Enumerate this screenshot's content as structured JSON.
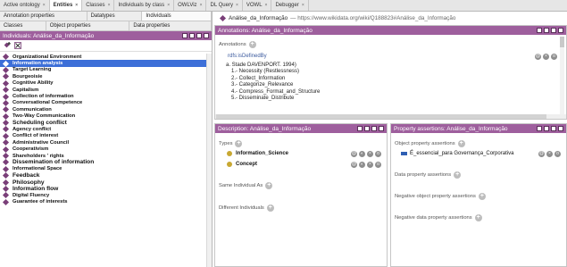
{
  "tabs": [
    {
      "label": "Active ontology",
      "active": false
    },
    {
      "label": "Entities",
      "active": true
    },
    {
      "label": "Classes",
      "active": false
    },
    {
      "label": "Individuals by class",
      "active": false
    },
    {
      "label": "OWLViz",
      "active": false
    },
    {
      "label": "DL Query",
      "active": false
    },
    {
      "label": "VOWL",
      "active": false
    },
    {
      "label": "Debugger",
      "active": false
    }
  ],
  "close_glyph": "×",
  "left": {
    "subtabs_row1": [
      "Annotation properties",
      "Datatypes",
      "Individuals"
    ],
    "subtabs_row2": [
      "Classes",
      "Object properties",
      "Data properties"
    ],
    "panel_title": "Individuals: Análise_da_Informação",
    "toolbar_icons": [
      "add-individual-icon",
      "delete-individual-icon"
    ],
    "items": [
      {
        "label": "Organizational Environment",
        "big": false
      },
      {
        "label": "Information analysis",
        "big": false,
        "selected": true
      },
      {
        "label": "Target Learning",
        "big": false
      },
      {
        "label": "Bourgeoisie",
        "big": false
      },
      {
        "label": "Cognitive Ability",
        "big": false
      },
      {
        "label": "Capitalism",
        "big": false
      },
      {
        "label": "Collection of information",
        "big": false
      },
      {
        "label": "Conversational Competence",
        "big": false
      },
      {
        "label": "Communication",
        "big": false
      },
      {
        "label": "Two-Way Communication",
        "big": false
      },
      {
        "label": "Scheduling conflict",
        "big": true
      },
      {
        "label": "Agency conflict",
        "big": false
      },
      {
        "label": "Conflict of interest",
        "big": false
      },
      {
        "label": "Administrative Council",
        "big": false
      },
      {
        "label": "Cooperativism",
        "big": false
      },
      {
        "label": "Shareholders ' rights",
        "big": false
      },
      {
        "label": "Dissemination of information",
        "big": true
      },
      {
        "label": "Informational Space",
        "big": false
      },
      {
        "label": "Feedback",
        "big": true
      },
      {
        "label": "Philosophy",
        "big": true
      },
      {
        "label": "Information flow",
        "big": true
      },
      {
        "label": "Digital Fluency",
        "big": false
      },
      {
        "label": "Guarantee of interests",
        "big": false
      }
    ]
  },
  "header": {
    "entity": "Análise_da_Informação",
    "iri": "— https://www.wikidata.org/wiki/Q188823#Análise_da_Informação"
  },
  "annotations": {
    "title": "Annotations: Análise_da_Informação",
    "section_label": "Annotations",
    "property": "rdfs:isDefinedBy",
    "line1": "a. Stade   DAVENPORT. 1994)",
    "items": [
      "1.- Necessity (Restlessness)",
      "2.- Collect_Information",
      "3.- Categorize_Relevance",
      "4.- Compress_Format_and_Structure",
      "5.- Disseminate_Distribute"
    ]
  },
  "description": {
    "title": "Description: Análise_da_Informação",
    "types_label": "Types",
    "types": [
      "Information_Science",
      "Concept"
    ],
    "same_label": "Same Individual As",
    "different_label": "Different Individuals"
  },
  "property_assertions": {
    "title": "Property assertions: Análise_da_Informação",
    "object_label": "Object property assertions",
    "object_items": [
      "É_essencial_para  Governança_Corporativa"
    ],
    "data_label": "Data property assertions",
    "neg_object_label": "Negative object property assertions",
    "neg_data_label": "Negative data property assertions"
  },
  "colors": {
    "panel_header": "#9e5f9d",
    "selection": "#3d6fd8",
    "individual_diamond": "#7a3f79",
    "class_circle": "#c8a832",
    "property_bar": "#2f5fb3"
  },
  "button_glyphs": {
    "add": "+",
    "help": "@",
    "edit": "◐",
    "delete": "×",
    "ok": "o"
  }
}
